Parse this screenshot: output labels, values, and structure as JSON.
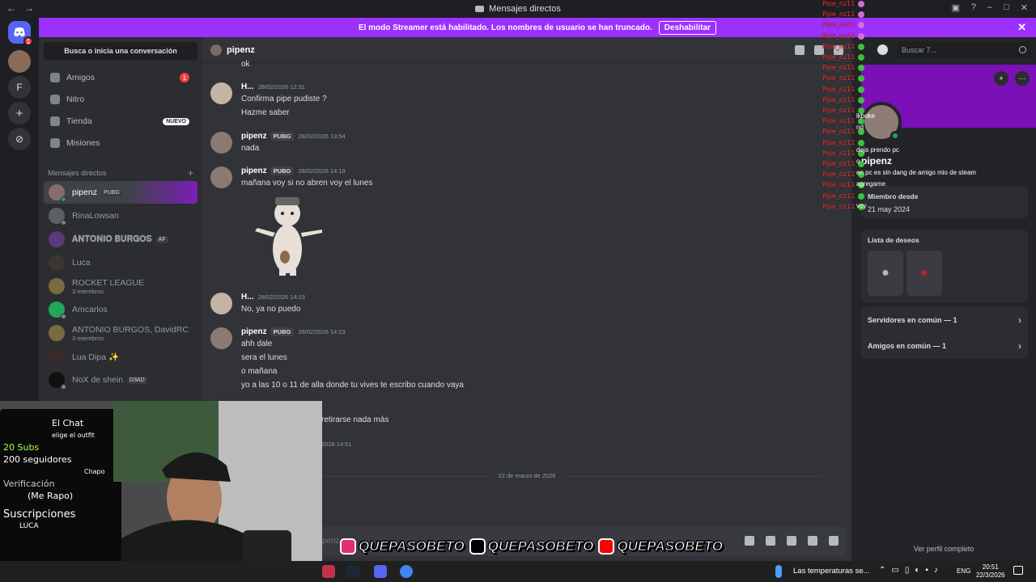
{
  "window": {
    "title": "Mensajes directos"
  },
  "streamer_banner": {
    "text": "El modo Streamer está habilitado. Los nombres de usuario se han truncado.",
    "button": "Deshabilitar"
  },
  "servers": [
    {
      "label": "",
      "badge": "1"
    },
    {
      "label": ""
    },
    {
      "label": "F"
    },
    {
      "label": "+"
    },
    {
      "label": "⊘"
    }
  ],
  "dm_sidebar": {
    "search": "Busca o inicia una conversación",
    "nav": [
      {
        "label": "Amigos",
        "count": "1"
      },
      {
        "label": "Nitro"
      },
      {
        "label": "Tienda",
        "pill": "NUEVO"
      },
      {
        "label": "Misiones"
      }
    ],
    "section": "Mensajes directos",
    "dms": [
      {
        "name": "pipenz",
        "tag": "PUBG"
      },
      {
        "name": "RinaLowsan"
      },
      {
        "name": "𝐀𝐍𝐓𝐎𝐍𝐈𝐎 𝐁𝐔𝐑𝐆𝐎𝐒",
        "tag": "AF"
      },
      {
        "name": "Luca"
      },
      {
        "name": "ROCKET LEAGUE",
        "sub": "3 miembros"
      },
      {
        "name": "Amcarlos"
      },
      {
        "name": "ANTONIO BURGOS, DavidRC",
        "sub": "3 miembros"
      },
      {
        "name": "Lua Dipa ✨"
      },
      {
        "name": "NoX de shein",
        "tag": "D3AD"
      }
    ]
  },
  "chat": {
    "title": "pipenz",
    "messages": [
      {
        "lines": [
          "ok"
        ]
      },
      {
        "name": "H...",
        "time": "28/02/2026 12:31",
        "lines": [
          "Confirma pipe pudiste ?",
          "Hazme saber"
        ]
      },
      {
        "name": "pipenz",
        "tag": "PUBG",
        "time": "28/02/2026 13:54",
        "lines": [
          "nada"
        ]
      },
      {
        "name": "pipenz",
        "tag": "PUBG",
        "time": "28/02/2026 14:18",
        "lines": [
          "mañana voy si no abren voy el lunes"
        ]
      },
      {
        "name": "H...",
        "time": "28/02/2026 14:23",
        "lines": [
          "No, ya no puedo"
        ]
      },
      {
        "name": "pipenz",
        "tag": "PUBG",
        "time": "28/02/2026 14:23",
        "lines": [
          "ahh dale",
          "sera el lunes",
          "o mañana",
          "yo a las 10 o 11 de alla donde tu vives te escribo cuando vaya"
        ]
      },
      {
        "lines": [
          "retirarse nada más"
        ],
        "time": "2026 14:51"
      }
    ],
    "date_divider": "22 de marzo de 2026",
    "composer_placeholder": "penz"
  },
  "profile": {
    "search_placeholder": "Buscar 7...",
    "name": "pipenz",
    "member_since_label": "Miembro desde",
    "member_since": "21 may 2024",
    "wishlist_label": "Lista de deseos",
    "servers_common": "Servidores en común — 1",
    "friends_common": "Amigos en común — 1",
    "view_full": "Ver perfil completo"
  },
  "chat_overlay": {
    "names": [
      "Pipe_nz11",
      "Pipe_nz11",
      "Pipe_nz11",
      "Pipe_nz11",
      "Pipe_nz11",
      "Pipe_nz11",
      "Pipe_nz11",
      "Pipe_nz11",
      "Pipe_nz11",
      "Pipe_nz11",
      "Pipe_nz11",
      "Pipe_nz11",
      "Pipe_nz11",
      "Pipe_nz11",
      "Pipe_nz11",
      "Pipe_nz11",
      "Pipe_nz11",
      "Pipe_nz11",
      "Pipe_nz11",
      "Pipe_nz11"
    ],
    "fragments": [
      "lkboke",
      "nd",
      "deja prendo pc",
      "o",
      "en pc es sin dang de amigo mio de steam",
      "agregame",
      "voy"
    ]
  },
  "stream_overlay": {
    "handles": [
      "QUEPASOBETO",
      "QUEPASOBETO",
      "QUEPASOBETO"
    ],
    "whiteboard": [
      "El Chat",
      "elige el outfit",
      "20 Subs",
      "200 seguidores",
      "Chapo",
      "Verificación",
      "(Me Rapo)",
      "Suscripciones",
      "LUCA"
    ]
  },
  "taskbar": {
    "weather": "Las temperaturas se...",
    "lang": "ENG",
    "time": "20:51",
    "date": "22/3/2026"
  },
  "colors": {
    "accent": "#9b30ff",
    "online": "#23a55a",
    "badge": "#f23f43",
    "blurple": "#5865f2"
  }
}
